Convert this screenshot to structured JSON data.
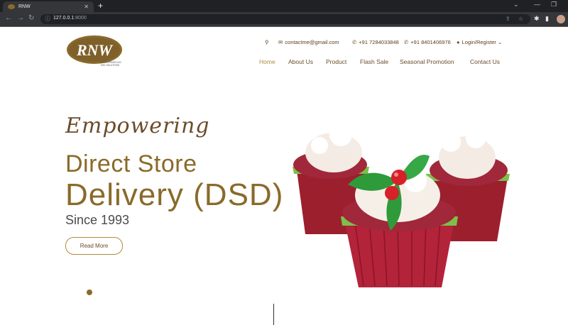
{
  "browser": {
    "tab_title": "RNW",
    "tab_close": "✕",
    "new_tab": "+",
    "url_host": "127.0.0.1",
    "url_port": ":8000"
  },
  "site": {
    "logo_text": "RNW",
    "logo_sub1": "ENTERPRISES INC",
    "logo_sub2": "DSD SOLUTIONS",
    "email": "contactme@gmail.com",
    "phone1": "+91 7284033848",
    "phone2": "+91 8401406976",
    "login": "Login/Register",
    "nav": [
      {
        "label": "Home"
      },
      {
        "label": "About Us"
      },
      {
        "label": "Product"
      },
      {
        "label": "Flash Sale"
      },
      {
        "label": "Seasonal Promotion"
      },
      {
        "label": "Contact Us"
      }
    ]
  },
  "hero": {
    "script_text": "Empowering",
    "headline_1": "Direct Store",
    "headline_2": "Delivery (DSD)",
    "since": "Since 1993",
    "cta": "Read More"
  },
  "colors": {
    "brand_gold": "#8a6a2a",
    "brand_brown": "#6b4c2a",
    "nav_active": "#b08a3e",
    "chrome_dark": "#202124"
  }
}
